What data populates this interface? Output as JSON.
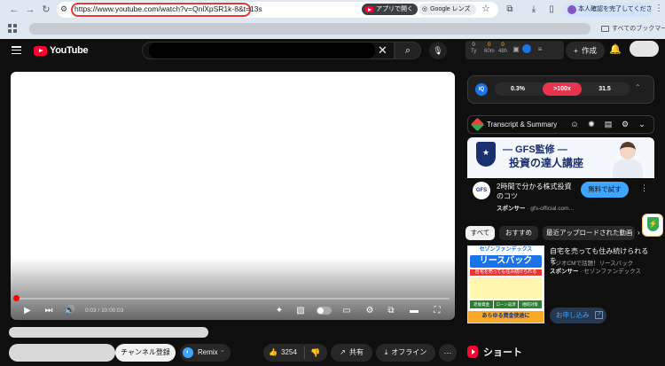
{
  "browser": {
    "url": "https://www.youtube.com/watch?v=QnlXpSR1k-8&t=13s",
    "open_in_app_label": "アプリで開く",
    "google_lens_label": "Google レンズ",
    "profile_label": "本人確認を完了してください",
    "bookmarks_folder_label": "すべてのブックマーク"
  },
  "youtube": {
    "logo_text": "YouTube",
    "create_label": "作成",
    "extension_stats": {
      "item1_value": "0",
      "item1_label": "Ty",
      "item2_value": "0",
      "item2_label": "60m",
      "item3_value": "0",
      "item3_label": "48h"
    }
  },
  "player": {
    "time_display": "0:03 / 10:00:03",
    "progress_fraction": 0.005
  },
  "actions": {
    "subscribe_label": "チャンネル登録",
    "remix_label": "Remix",
    "like_count": "3254",
    "share_label": "共有",
    "offline_label": "オフライン"
  },
  "stats_panel": {
    "badge": "IQ",
    "pills": [
      "0.3%",
      ">100x",
      "31.5"
    ],
    "highlight_color": "#e8344e"
  },
  "transcript": {
    "label": "Transcript & Summary"
  },
  "ad1": {
    "banner_line1": "— GFS監修 —",
    "banner_line2": "投資の達人講座",
    "logo_text": "GFS",
    "title": "2時間で分かる株式投資のコツ",
    "sponsor_label": "スポンサー",
    "sponsor_domain": "gfs-official.com...",
    "cta_label": "無料で試す"
  },
  "chips": [
    {
      "label": "すべて",
      "active": true
    },
    {
      "label": "おすすめ",
      "active": false
    },
    {
      "label": "最近アップロードされた動画",
      "active": false
    }
  ],
  "ad2": {
    "thumb_top": "セゾンファンデックス",
    "thumb_big": "リースバック",
    "thumb_band": "自宅を売っても住み続けられる",
    "thumb_row": [
      "老後資金",
      "ローン返済",
      "相続対策"
    ],
    "thumb_foot": "あらゆる資金使途に",
    "title": "自宅を売っても住み続けられるを",
    "desc": "ラジオCMで話題！リースバック",
    "sponsor_label": "スポンサー",
    "sponsor_name": "セゾンファンデックス",
    "cta_label": "お申し込み"
  },
  "shorts": {
    "label": "ショート"
  }
}
